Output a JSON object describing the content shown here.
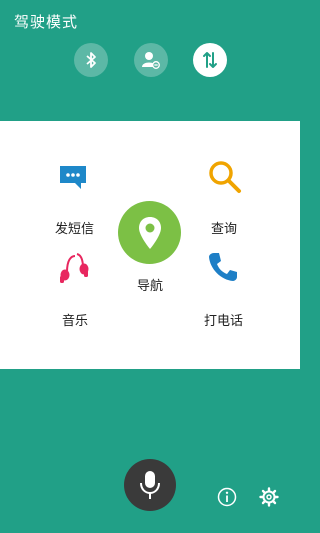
{
  "header": {
    "title": "驾驶模式",
    "toggles": [
      {
        "icon": "bluetooth-icon",
        "state": "off"
      },
      {
        "icon": "contact-block-icon",
        "state": "off"
      },
      {
        "icon": "data-transfer-icon",
        "state": "on"
      }
    ]
  },
  "features": {
    "sms": {
      "label": "发短信",
      "icon": "sms-bubble-icon",
      "color": "#1e88c9"
    },
    "search": {
      "label": "查询",
      "icon": "search-icon",
      "color": "#f0a400"
    },
    "navigation": {
      "label": "导航",
      "icon": "location-pin-icon",
      "color": "#7cc045"
    },
    "music": {
      "label": "音乐",
      "icon": "earphones-icon",
      "color": "#e8275f"
    },
    "call": {
      "label": "打电话",
      "icon": "phone-icon",
      "color": "#1e7fc6"
    }
  },
  "bottom": {
    "mic_icon": "microphone-icon",
    "info_icon": "info-icon",
    "settings_icon": "gear-icon"
  },
  "colors": {
    "primary": "#21a087",
    "panel": "#ffffff",
    "mic": "#3a3a3a"
  }
}
